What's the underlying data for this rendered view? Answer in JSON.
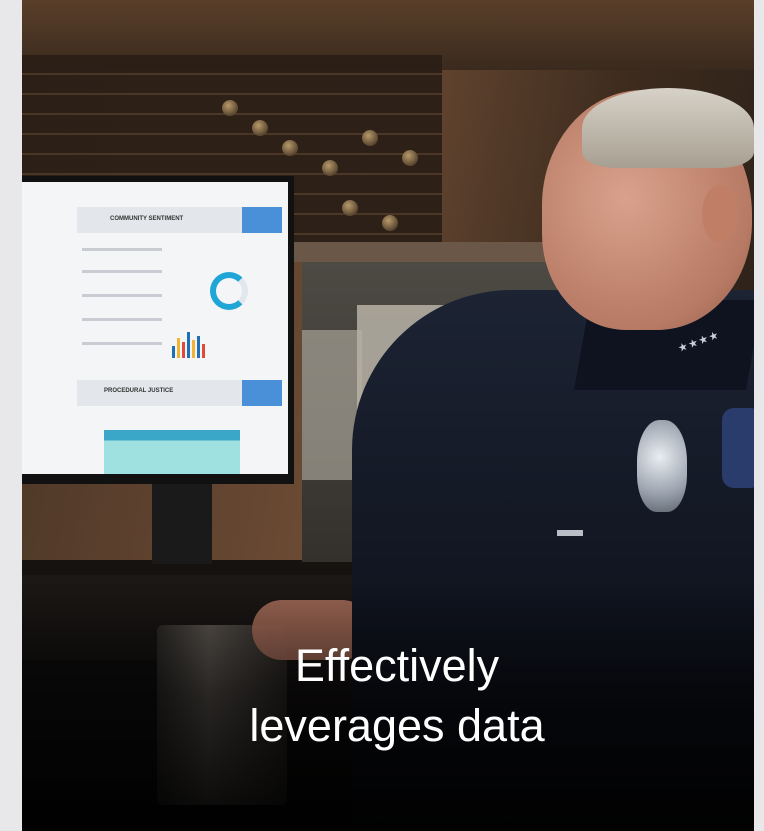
{
  "photo": {
    "subject": "police-officer-at-computer",
    "screen": {
      "section_1_title": "COMMUNITY SENTIMENT",
      "section_2_title": "PROCEDURAL JUSTICE"
    },
    "uniform_color": "#10141f"
  },
  "caption": {
    "line1": "Effectively",
    "line2": "leverages data",
    "color": "#ffffff"
  }
}
